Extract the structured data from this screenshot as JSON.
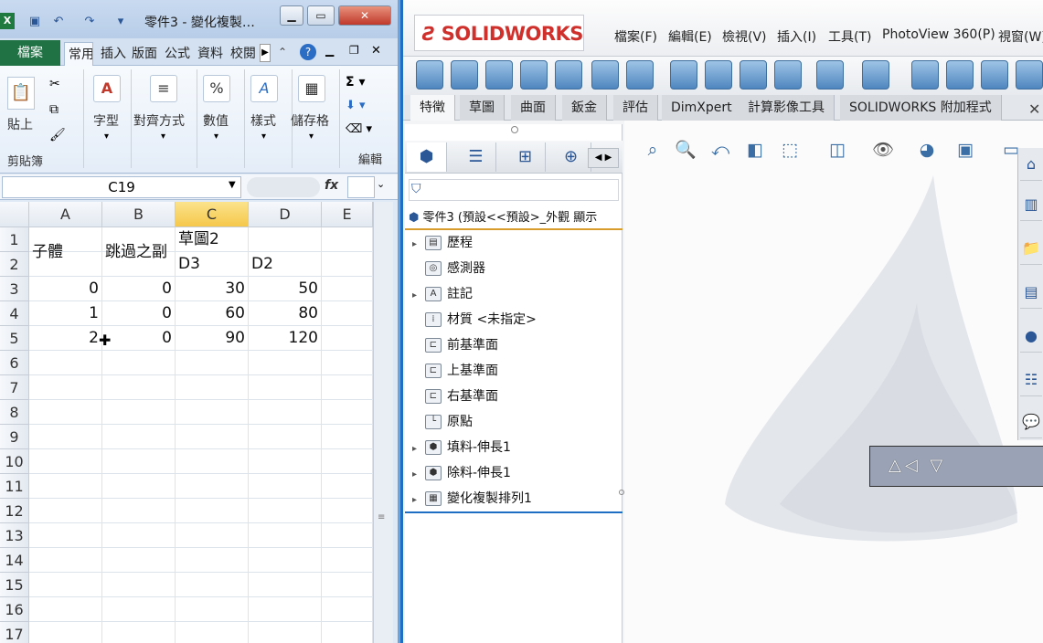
{
  "excel": {
    "title": "零件3 - 變化複製…",
    "logo": "X",
    "tabs": [
      "檔案",
      "常用",
      "插入",
      "版面",
      "公式",
      "資料",
      "校閱"
    ],
    "ribbon": {
      "clipboard_group": "剪貼簿",
      "paste": "貼上",
      "font": "字型",
      "alignment": "對齊方式",
      "number": "數值",
      "styles": "樣式",
      "cells": "儲存格",
      "editing": "編輯"
    },
    "name_box": "C19",
    "fx": "fx",
    "columns": [
      "A",
      "B",
      "C",
      "D",
      "E"
    ],
    "rows": [
      "1",
      "2",
      "3",
      "4",
      "5",
      "6",
      "7",
      "8",
      "9",
      "10",
      "11",
      "12",
      "13",
      "14",
      "15",
      "16",
      "17"
    ],
    "cells": {
      "A1": "子體",
      "B1": "跳過之副",
      "C1": "草圖2",
      "C2": "D3",
      "D2": "D2",
      "A3": "0",
      "B3": "0",
      "C3": "30",
      "D3": "50",
      "A4": "1",
      "B4": "0",
      "C4": "60",
      "D4": "80",
      "A5": "2",
      "B5": "0",
      "C5": "90",
      "D5": "120"
    }
  },
  "solidworks": {
    "logo": "SOLIDWORKS",
    "menu": [
      "檔案(F)",
      "編輯(E)",
      "檢視(V)",
      "插入(I)",
      "工具(T)",
      "PhotoView 360(P)",
      "視窗(W)"
    ],
    "command_tabs": [
      "特徵",
      "草圖",
      "曲面",
      "鈑金",
      "評估",
      "DimXpert",
      "計算影像工具",
      "SOLIDWORKS 附加程式"
    ],
    "tree_root": "零件3 (預設<<預設>_外觀 顯示",
    "tree": [
      {
        "label": "歷程",
        "expand": true
      },
      {
        "label": "感測器",
        "expand": false
      },
      {
        "label": "註記",
        "expand": true
      },
      {
        "label": "材質 <未指定>",
        "expand": false
      },
      {
        "label": "前基準面",
        "expand": false
      },
      {
        "label": "上基準面",
        "expand": false
      },
      {
        "label": "右基準面",
        "expand": false
      },
      {
        "label": "原點",
        "expand": false
      },
      {
        "label": "填料-伸長1",
        "expand": true
      },
      {
        "label": "除料-伸長1",
        "expand": true
      },
      {
        "label": "變化複製排列1",
        "expand": true
      }
    ],
    "dialog_text": "△◁ ▽"
  }
}
